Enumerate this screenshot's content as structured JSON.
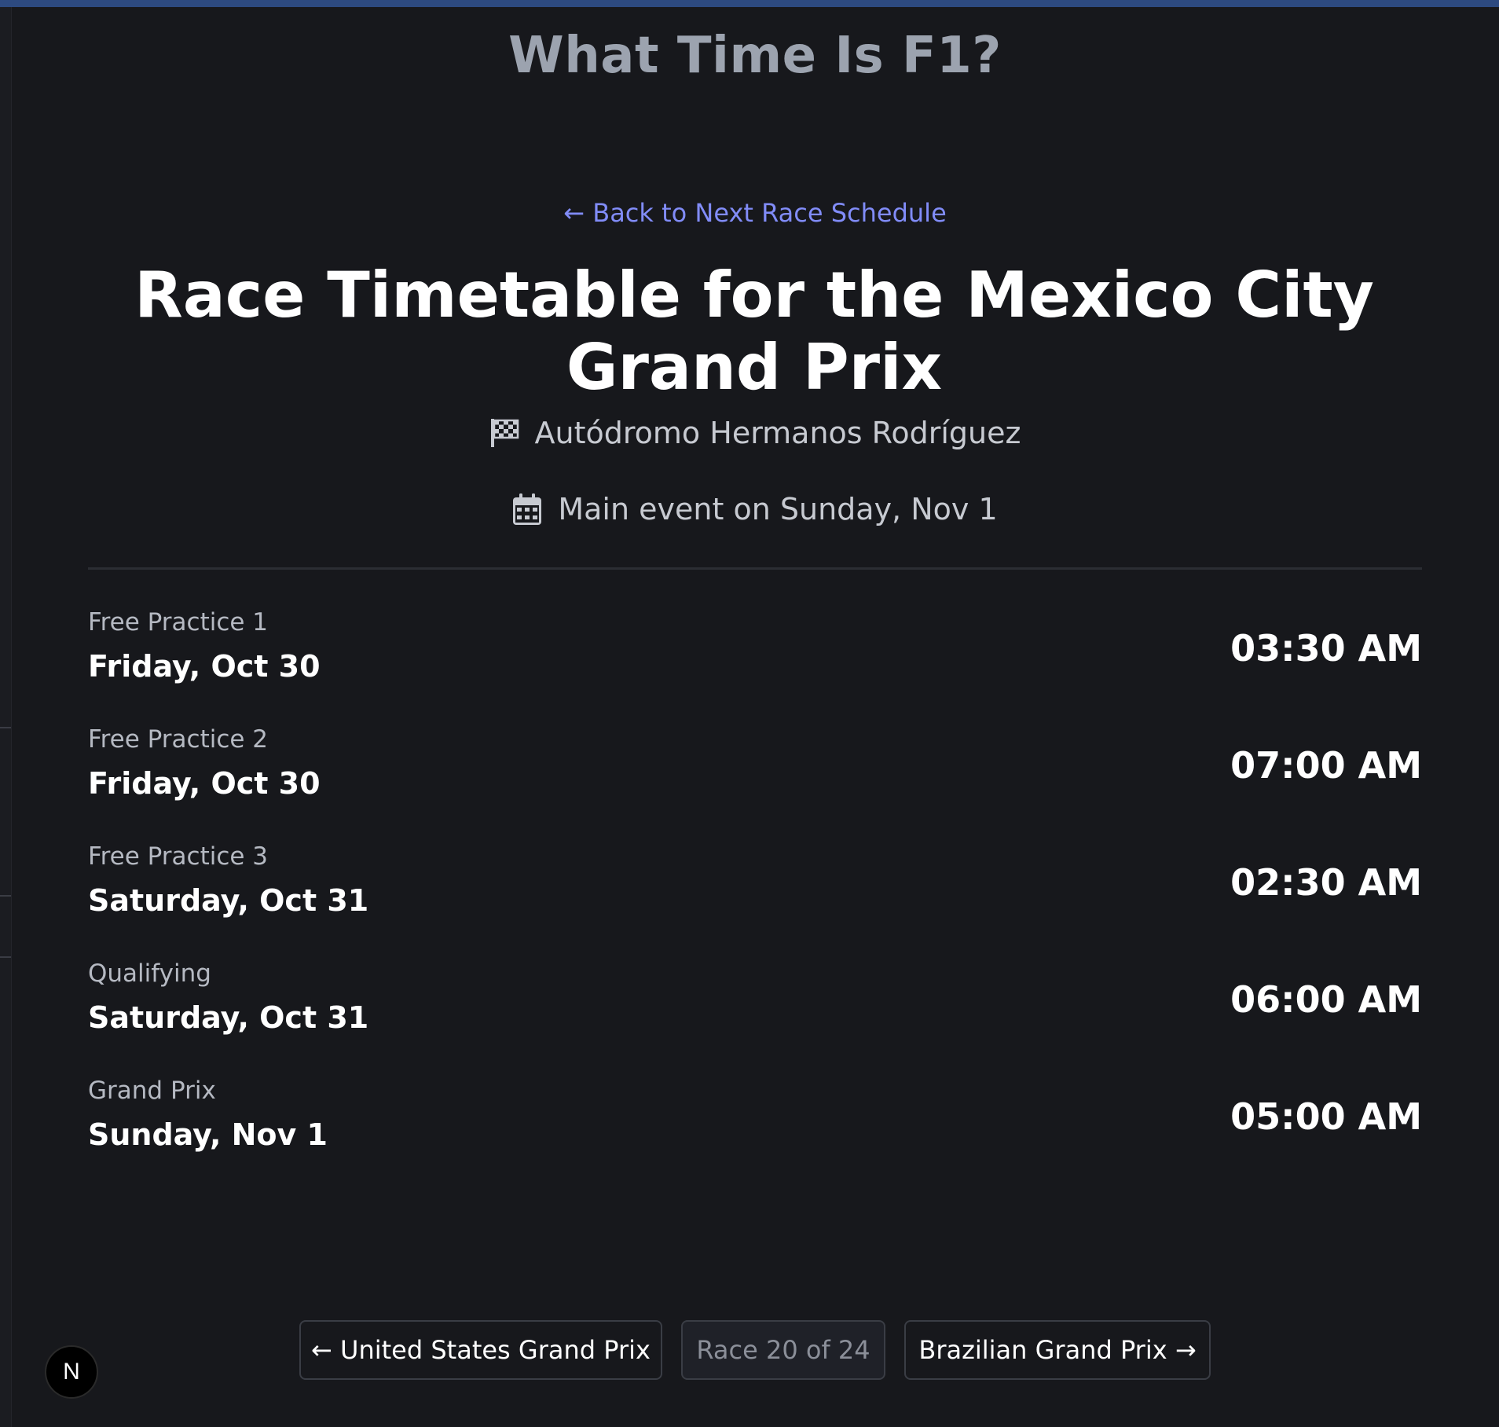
{
  "site": {
    "title": "What Time Is F1?"
  },
  "nav": {
    "back_link": "← Back to Next Race Schedule"
  },
  "race": {
    "title": "Race Timetable for the Mexico City Grand Prix",
    "circuit_icon": "checkered-flag-icon",
    "circuit": "Autódromo Hermanos Rodríguez",
    "date_icon": "calendar-icon",
    "main_event": "Main event on Sunday, Nov 1"
  },
  "sessions": [
    {
      "name": "Free Practice 1",
      "day": "Friday, Oct 30",
      "time": "03:30 AM"
    },
    {
      "name": "Free Practice 2",
      "day": "Friday, Oct 30",
      "time": "07:00 AM"
    },
    {
      "name": "Free Practice 3",
      "day": "Saturday, Oct 31",
      "time": "02:30 AM"
    },
    {
      "name": "Qualifying",
      "day": "Saturday, Oct 31",
      "time": "06:00 AM"
    },
    {
      "name": "Grand Prix",
      "day": "Sunday, Nov 1",
      "time": "05:00 AM"
    }
  ],
  "pager": {
    "prev_label": "← United States Grand Prix",
    "count_label": "Race 20 of 24",
    "next_label": "Brazilian Grand Prix →"
  },
  "badge": {
    "letter": "N"
  },
  "colors": {
    "background": "#17181c",
    "link": "#818cf8",
    "muted_title": "#9ca3af",
    "top_bar": "#2d4a80"
  }
}
